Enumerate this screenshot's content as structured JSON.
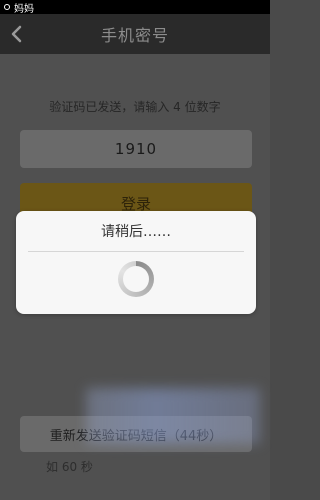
{
  "status_bar": {
    "text": "妈妈"
  },
  "header": {
    "title": "手机密号",
    "back_icon": "chevron-left-icon"
  },
  "form": {
    "hint": "验证码已发送，请输入 4 位数字",
    "code_value": "1910",
    "login_label": "登录",
    "resend_label": "重新发送验证码短信（44秒）",
    "note": "如 60 秒"
  },
  "dialog": {
    "message": "请稍后……",
    "spinner_icon": "loading-spinner-icon"
  },
  "colors": {
    "nav_bar": "#2a2a2a",
    "login_button": "#6b5616",
    "dialog_bg": "#f7f7f7"
  }
}
